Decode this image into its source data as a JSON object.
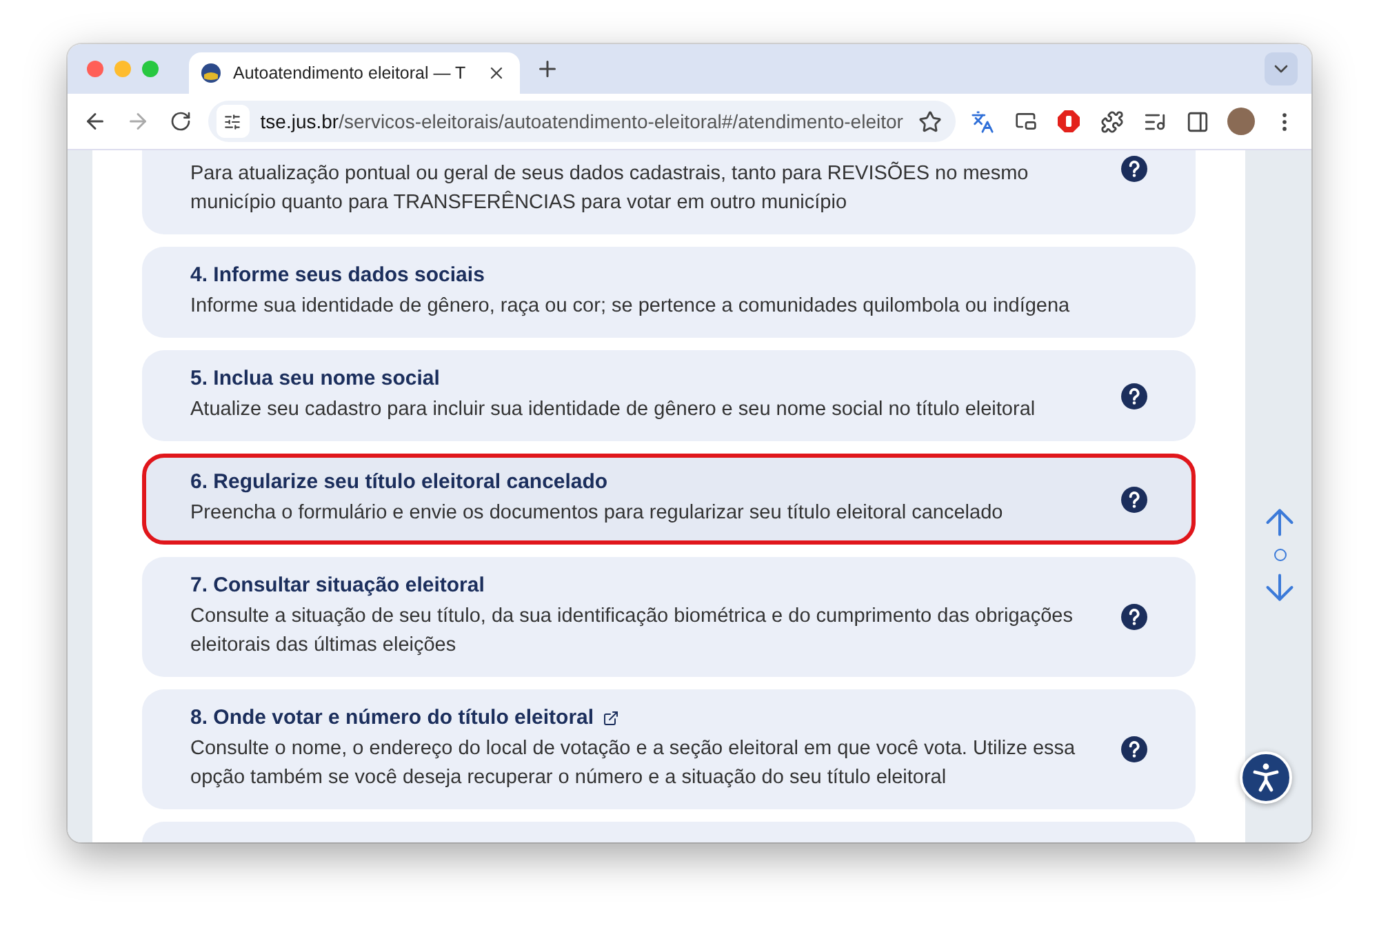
{
  "browser": {
    "tab_title": "Autoatendimento eleitoral — T",
    "url_host": "tse.jus.br",
    "url_path": "/servicos-eleitorais/autoatendimento-eleitoral#/atendimento-eleitor"
  },
  "cards": [
    {
      "description": "Para atualização pontual ou geral de seus dados cadastrais, tanto para REVISÕES no mesmo município quanto para TRANSFERÊNCIAS para votar em outro município",
      "help": true,
      "highlighted": false,
      "external": false
    },
    {
      "title": "4. Informe seus dados sociais",
      "description": "Informe sua identidade de gênero, raça ou cor; se pertence a comunidades quilombola ou indígena",
      "help": false,
      "highlighted": false,
      "external": false
    },
    {
      "title": "5. Inclua seu nome social",
      "description": "Atualize seu cadastro para incluir sua identidade de gênero e seu nome social no título eleitoral",
      "help": true,
      "highlighted": false,
      "external": false
    },
    {
      "title": "6. Regularize seu título eleitoral cancelado",
      "description": "Preencha o formulário e envie os documentos para regularizar seu título eleitoral cancelado",
      "help": true,
      "highlighted": true,
      "external": false
    },
    {
      "title": "7. Consultar situação eleitoral",
      "description": "Consulte a situação de seu título, da sua identificação biométrica e do cumprimento das obrigações eleitorais das últimas eleições",
      "help": true,
      "highlighted": false,
      "external": false
    },
    {
      "title": "8. Onde votar e número do título eleitoral",
      "description": "Consulte o nome, o endereço do local de votação e a seção eleitoral em que você vota. Utilize essa opção também se você deseja recuperar o número e a situação do seu título eleitoral",
      "help": true,
      "highlighted": false,
      "external": true
    },
    {
      "help": false,
      "highlighted": false,
      "external": false
    }
  ]
}
